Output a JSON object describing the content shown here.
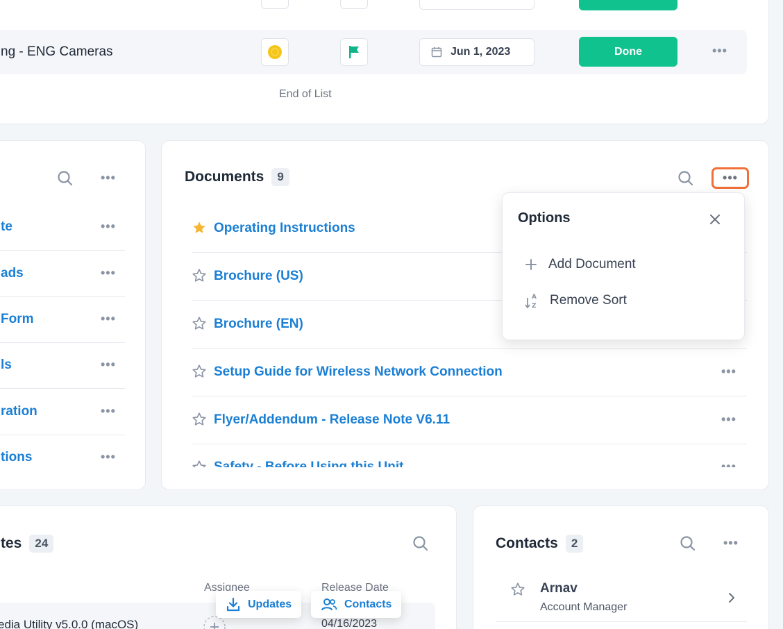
{
  "top_card": {
    "row": {
      "name": "ng - ENG Cameras",
      "date": "Jun 1, 2023",
      "status": "Done"
    },
    "end_of_list": "End of List",
    "colors": {
      "done": "#10c28e",
      "flag": "#10b48a",
      "avatar": "#f5c518"
    }
  },
  "left_card": {
    "items": [
      {
        "label": "te"
      },
      {
        "label": "ads"
      },
      {
        "label": "Form"
      },
      {
        "label": "ls"
      },
      {
        "label": "ration"
      },
      {
        "label": "tions"
      }
    ]
  },
  "documents": {
    "title": "Documents",
    "count": "9",
    "items": [
      {
        "label": "Operating Instructions",
        "starred": true
      },
      {
        "label": "Brochure (US)",
        "starred": false
      },
      {
        "label": "Brochure (EN)",
        "starred": false
      },
      {
        "label": "Setup Guide for Wireless Network Connection",
        "starred": false
      },
      {
        "label": "Flyer/Addendum - Release Note V6.11",
        "starred": false
      },
      {
        "label": "Safety - Before Using this Unit",
        "starred": false
      }
    ],
    "options": {
      "title": "Options",
      "items": [
        {
          "label": "Add Document",
          "icon": "plus-icon"
        },
        {
          "label": "Remove Sort",
          "icon": "sort-az-icon"
        }
      ]
    },
    "colors": {
      "menu_highlight": "#f0703a",
      "star_filled": "#f6b632",
      "link": "#1a7fd4"
    }
  },
  "updates_card": {
    "title": "tes",
    "count": "24",
    "columns": {
      "assignee": "Assignee",
      "release_date": "Release Date"
    },
    "row": {
      "name": "edia Utility v5.0.0 (macOS)",
      "date": "04/16/2023"
    }
  },
  "contacts": {
    "title": "Contacts",
    "count": "2",
    "person": {
      "name": "Arnav",
      "role": "Account Manager"
    }
  },
  "floating": {
    "updates": "Updates",
    "contacts": "Contacts"
  }
}
